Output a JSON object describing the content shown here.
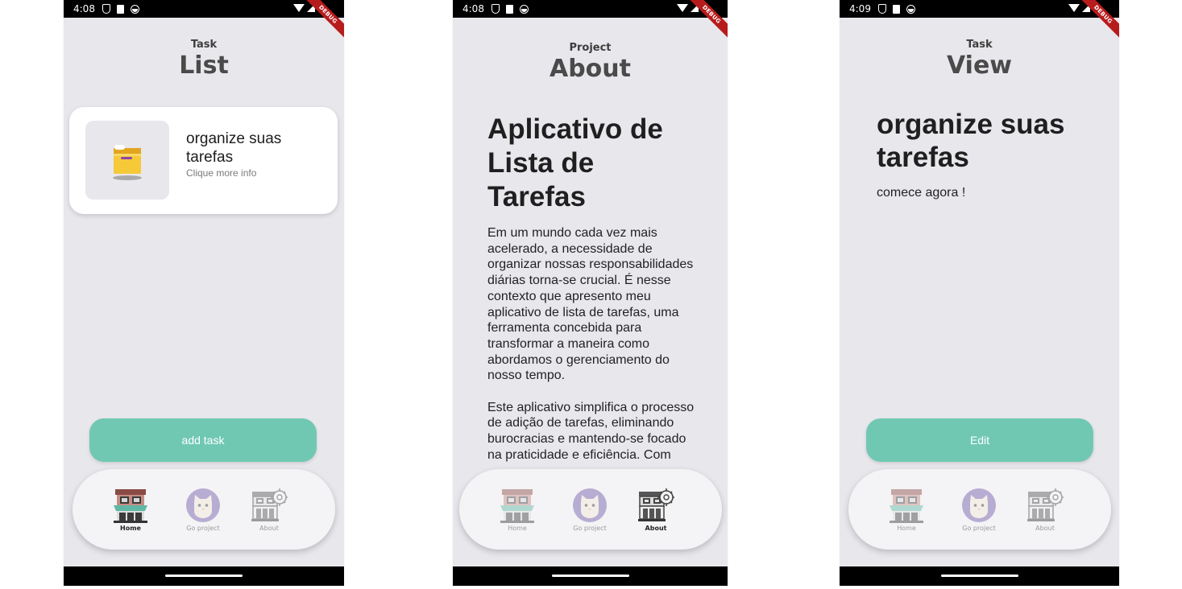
{
  "screens": {
    "list": {
      "status_time": "4:08",
      "debug": "DEBUG",
      "header_small": "Task",
      "header_big": "List",
      "task": {
        "title": "organize suas tarefas",
        "subtitle": "Clique more info"
      },
      "button": "add task"
    },
    "about": {
      "status_time": "4:08",
      "debug": "DEBUG",
      "header_small": "Project",
      "header_big": "About",
      "title": "Aplicativo de Lista de Tarefas",
      "paragraph1": "Em um mundo cada vez mais acelerado, a necessidade de organizar nossas responsabilidades diárias torna-se crucial. É nesse contexto que apresento meu aplicativo de lista de tarefas, uma ferramenta concebida para transformar a maneira como abordamos o gerenciamento do nosso tempo.",
      "paragraph2": "Este aplicativo simplifica o processo de adição de tarefas, eliminando burocracias e mantendo-se focado na praticidade e eficiência. Com"
    },
    "view": {
      "status_time": "4:09",
      "debug": "DEBUG",
      "header_small": "Task",
      "header_big": "View",
      "title": "organize suas tarefas",
      "description": "comece agora !",
      "button": "Edit"
    }
  },
  "nav": {
    "home": "Home",
    "go_project": "Go project",
    "about": "About"
  },
  "colors": {
    "accent": "#70c8b3",
    "background": "#e8e7ec",
    "nav_bg": "#f4f3f6"
  }
}
